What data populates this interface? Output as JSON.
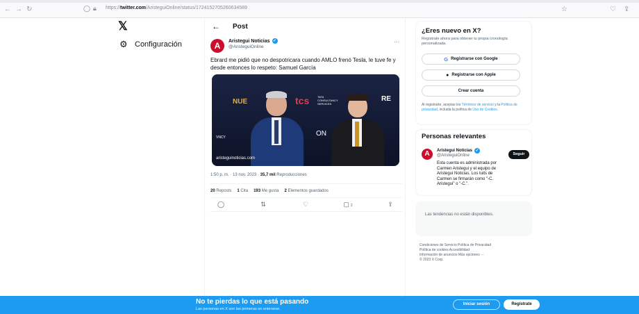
{
  "browser": {
    "back_icon": "arrow-left-icon",
    "forward_icon": "arrow-right-icon",
    "reload_icon": "reload-icon",
    "url_prefix": "https://",
    "url_domain": "twitter.com",
    "url_path": "/AristeguiOnline/status/1724152705260634589"
  },
  "nav": {
    "logo": "𝕏",
    "settings_label": "Configuración"
  },
  "main": {
    "header_title": "Post",
    "author_name": "Aristegui Noticias",
    "author_handle": "@AristeguiOnline",
    "avatar_letter": "A",
    "tweet_text": "Ebrard me pidió que no despotricara cuando AMLO frenó Tesla, le tuve fe y desde entonces lo respeto: Samuel García",
    "photo": {
      "logo_left": "NUE",
      "logo_tcs": "tcs",
      "logo_tata_line1": "TATA",
      "logo_tata_line2": "CONSULTANCY",
      "logo_tata_line3": "SERVICES",
      "logo_right": "RE",
      "logo_on": "ON",
      "logo_vncy": "VNCY",
      "watermark": "aristeguinoticias.com"
    },
    "meta": {
      "time": "1:50 p. m. · 13 nov. 2023 · ",
      "views_count": "35,7 mil",
      "views_label": " Reproducciones"
    },
    "stats": {
      "reposts_count": "20",
      "reposts_label": " Reposts",
      "quotes_count": "1",
      "quotes_label": " Cita",
      "likes_count": "193",
      "likes_label": " Me gusta",
      "bookmarks_count": "2",
      "bookmarks_label": " Elementos guardados"
    },
    "actions": {
      "bookmark_count": "2"
    }
  },
  "signup_card": {
    "title": "¿Eres nuevo en X?",
    "subtitle": "Regístrate ahora para obtener tu propia cronología personalizada.",
    "google_label": "Registrarse con Google",
    "apple_label": "Registrarse con Apple",
    "create_label": "Crear cuenta",
    "terms_pre": "Al registrarte, aceptas los ",
    "terms_link1": "Términos de servicio",
    "terms_mid1": " y la ",
    "terms_link2": "Política de privacidad",
    "terms_mid2": ", incluida la política de ",
    "terms_link3": "Uso de Cookies",
    "terms_end": "."
  },
  "relevant": {
    "title": "Personas relevantes",
    "avatar_letter": "A",
    "name": "Aristegui Noticias",
    "handle": "@AristeguiOnline",
    "follow_label": "Seguir",
    "bio": "Esta cuenta es administrada por Carmen Aristegui y el equipo de Aristegui Noticias. Los tuits de Carmen se firmarán como \"-C. Aristegui\" o \"-C.\"."
  },
  "trends": {
    "text": "Las tendencias no están disponibles."
  },
  "footer": {
    "line1": "Condiciones de Servicio   Política de Privacidad",
    "line2": "Política de cookies   Accesibilidad",
    "line3": "Información de anuncios   Más opciones ···",
    "line4": "© 2023 X Corp."
  },
  "banner": {
    "title": "No te pierdas lo que está pasando",
    "subtitle": "Las personas en X son las primeras en enterarse.",
    "login_label": "Iniciar sesión",
    "signup_label": "Regístrate"
  },
  "colors": {
    "brand_blue": "#1d9bf0",
    "text_primary": "#0f1419",
    "text_secondary": "#536471",
    "avatar_red": "#c8102e"
  }
}
